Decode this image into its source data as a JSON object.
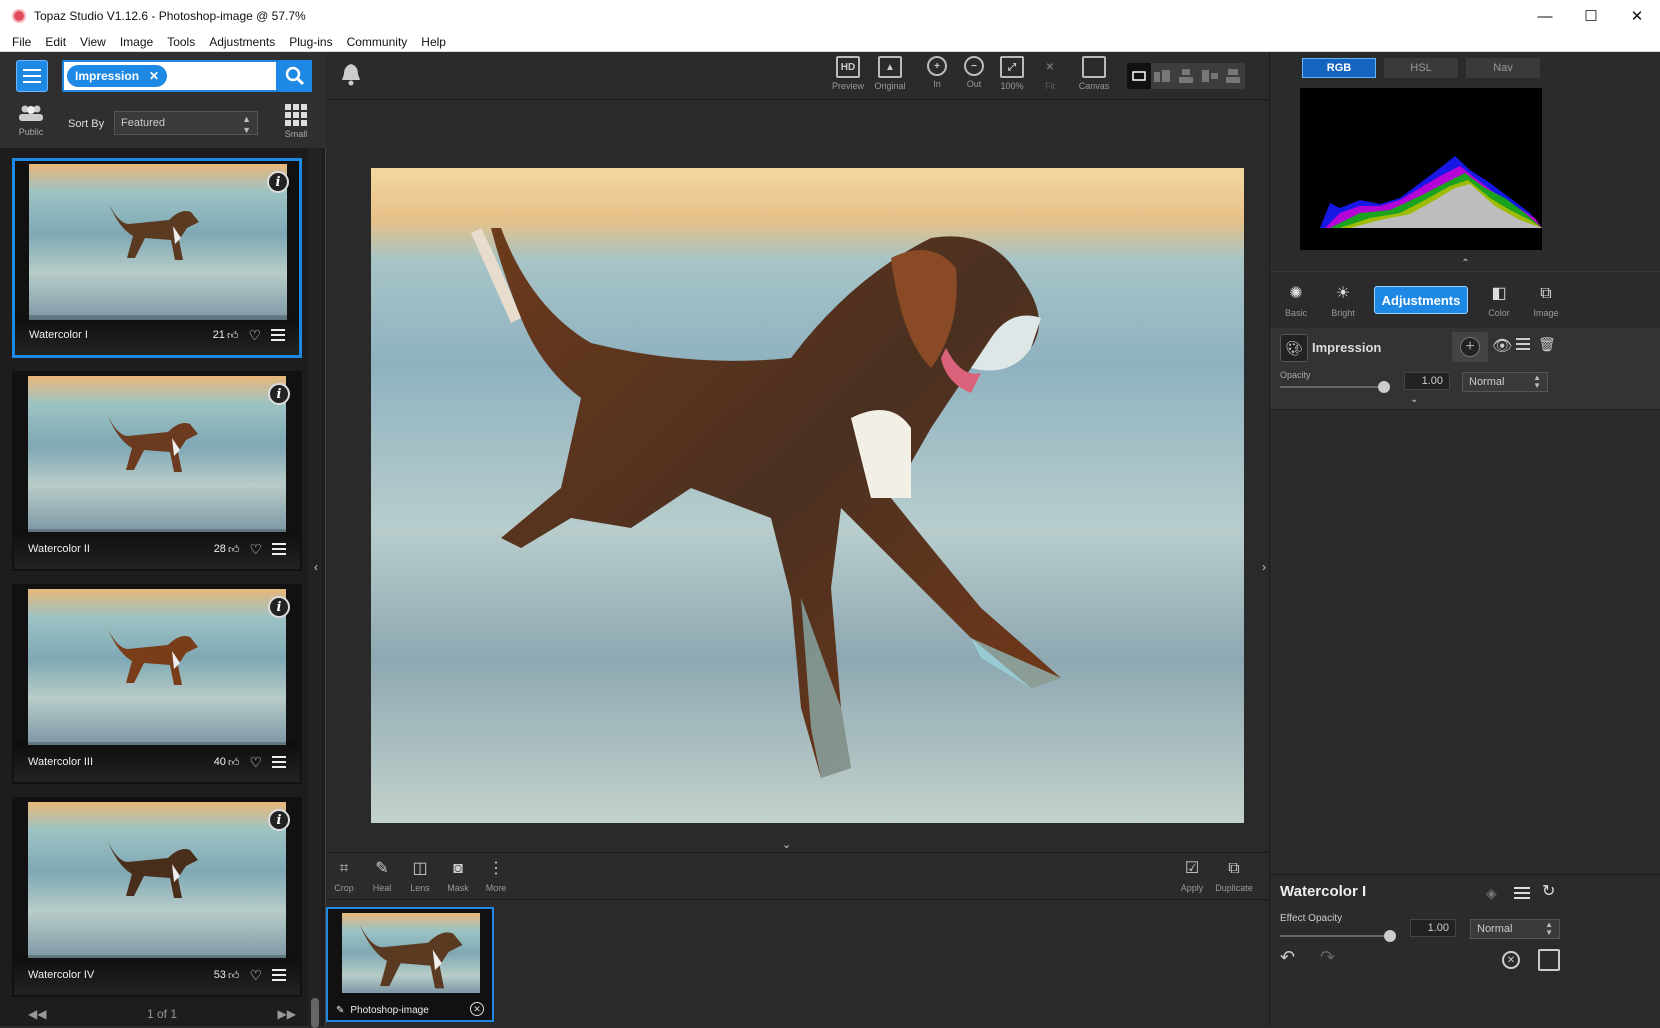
{
  "window": {
    "title": "Topaz Studio V1.12.6 - Photoshop-image @ 57.7%",
    "controls": {
      "minimize": "—",
      "maximize": "☐",
      "close": "✕"
    }
  },
  "menu": [
    "File",
    "Edit",
    "View",
    "Image",
    "Tools",
    "Adjustments",
    "Plug-ins",
    "Community",
    "Help"
  ],
  "left_panel": {
    "search_tag": "Impression",
    "public_label": "Public",
    "sort_label": "Sort By",
    "sort_value": "Featured",
    "view_label": "Small",
    "cards": [
      {
        "name": "Watercolor I",
        "likes": "21",
        "selected": true
      },
      {
        "name": "Watercolor II",
        "likes": "28",
        "selected": false
      },
      {
        "name": "Watercolor III",
        "likes": "40",
        "selected": false
      },
      {
        "name": "Watercolor IV",
        "likes": "53",
        "selected": false
      }
    ],
    "pager": "1 of 1"
  },
  "toolbar": {
    "items": [
      {
        "label": "Preview",
        "icon": "hd-icon"
      },
      {
        "label": "Original",
        "icon": "image-icon"
      },
      {
        "label": "In",
        "icon": "zoom-in-icon"
      },
      {
        "label": "Out",
        "icon": "zoom-out-icon"
      },
      {
        "label": "100%",
        "icon": "actual-size-icon"
      },
      {
        "label": "Fit",
        "icon": "fit-icon"
      },
      {
        "label": "Canvas",
        "icon": "canvas-icon"
      }
    ]
  },
  "bottom_tools": {
    "left": [
      {
        "label": "Crop",
        "icon": "crop-icon"
      },
      {
        "label": "Heal",
        "icon": "bandage-icon"
      },
      {
        "label": "Lens",
        "icon": "lens-icon"
      },
      {
        "label": "Mask",
        "icon": "mask-icon"
      },
      {
        "label": "More",
        "icon": "more-icon"
      }
    ],
    "right": [
      {
        "label": "Apply",
        "icon": "apply-icon"
      },
      {
        "label": "Duplicate",
        "icon": "duplicate-icon"
      }
    ]
  },
  "filmstrip": {
    "label": "Photoshop-image"
  },
  "right_panel": {
    "hist_tabs": [
      "RGB",
      "HSL",
      "Nav"
    ],
    "panel_tabs": [
      {
        "label": "Basic",
        "icon": "aperture-icon"
      },
      {
        "label": "Bright",
        "icon": "sun-icon"
      },
      {
        "label": "Adjustments",
        "icon": ""
      },
      {
        "label": "Color",
        "icon": "color-icon"
      },
      {
        "label": "Image",
        "icon": "images-icon"
      }
    ],
    "layer": {
      "name": "Impression",
      "opacity_label": "Opacity",
      "opacity_value": "1.00",
      "blend": "Normal"
    },
    "footer": {
      "title": "Watercolor I",
      "opacity_label": "Effect Opacity",
      "opacity_value": "1.00",
      "blend": "Normal"
    }
  },
  "colors": {
    "accent": "#1e88e5",
    "panel": "#2b2b2b",
    "dark": "#1d1d1d"
  }
}
